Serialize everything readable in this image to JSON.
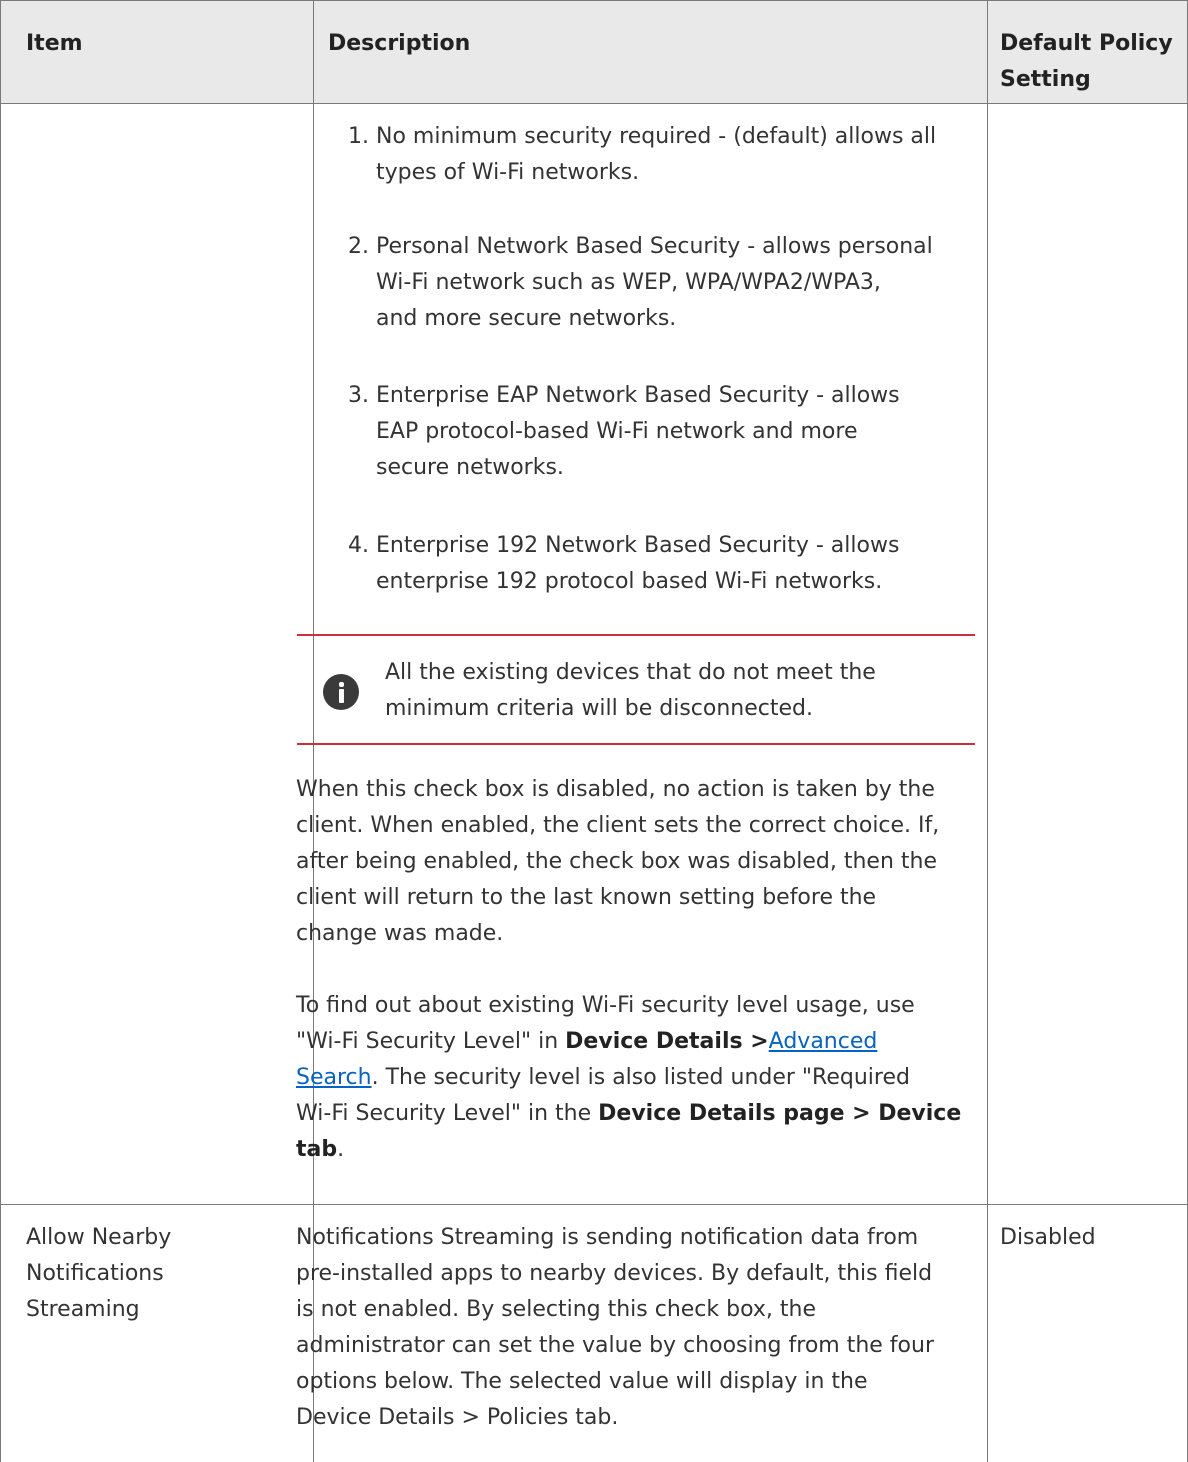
{
  "table": {
    "headers": {
      "item": "Item",
      "description": "Description",
      "default_line1": "Default Policy",
      "default_line2": "Setting"
    }
  },
  "row1": {
    "options": [
      {
        "num": "1.",
        "line1": "No minimum security required - (default) allows all",
        "line2": "types of Wi-Fi networks.",
        "line3": ""
      },
      {
        "num": "2.",
        "line1": "Personal Network Based Security - allows personal",
        "line2": "Wi-Fi network such as WEP, WPA/WPA2/WPA3,",
        "line3": "and more secure networks."
      },
      {
        "num": "3.",
        "line1": "Enterprise EAP Network Based Security - allows",
        "line2": "EAP protocol-based Wi-Fi network and more",
        "line3": "secure networks."
      },
      {
        "num": "4.",
        "line1": "Enterprise 192 Network Based Security - allows",
        "line2": "enterprise 192 protocol based Wi-Fi networks.",
        "line3": ""
      }
    ],
    "note": {
      "line1": "All the existing devices that do not meet the",
      "line2": "minimum criteria will be disconnected."
    },
    "para1": [
      "When this check box is disabled, no action is taken by the",
      "client. When enabled, the client sets the correct choice. If,",
      "after being enabled, the check box was disabled, then the",
      "client will return to the last known setting before the",
      "change was made."
    ],
    "para2": {
      "l1": "To find out about existing Wi-Fi security level usage, use",
      "l2a": "\"Wi-Fi Security Level\" in ",
      "l2b": "Device Details >",
      "l2link": "Advanced ",
      "l3link": "Search",
      "l3b": ". The security level is also listed under \"Required",
      "l4a": "Wi-Fi Security Level\" in the ",
      "l4b": "Device Details page > Device",
      "l5b": "tab",
      "l5c": "."
    }
  },
  "row2": {
    "item_line1": "Allow Nearby",
    "item_line2": "Notifications",
    "item_line3": "Streaming",
    "desc": [
      "Notifications Streaming is sending notification data from",
      "pre-installed apps to nearby devices. By default, this field",
      "is not enabled. By selecting this check box, the",
      "administrator can set the value by choosing from the four",
      "options below. The selected value will display in the",
      "Device Details > Policies tab."
    ],
    "default": "Disabled"
  }
}
